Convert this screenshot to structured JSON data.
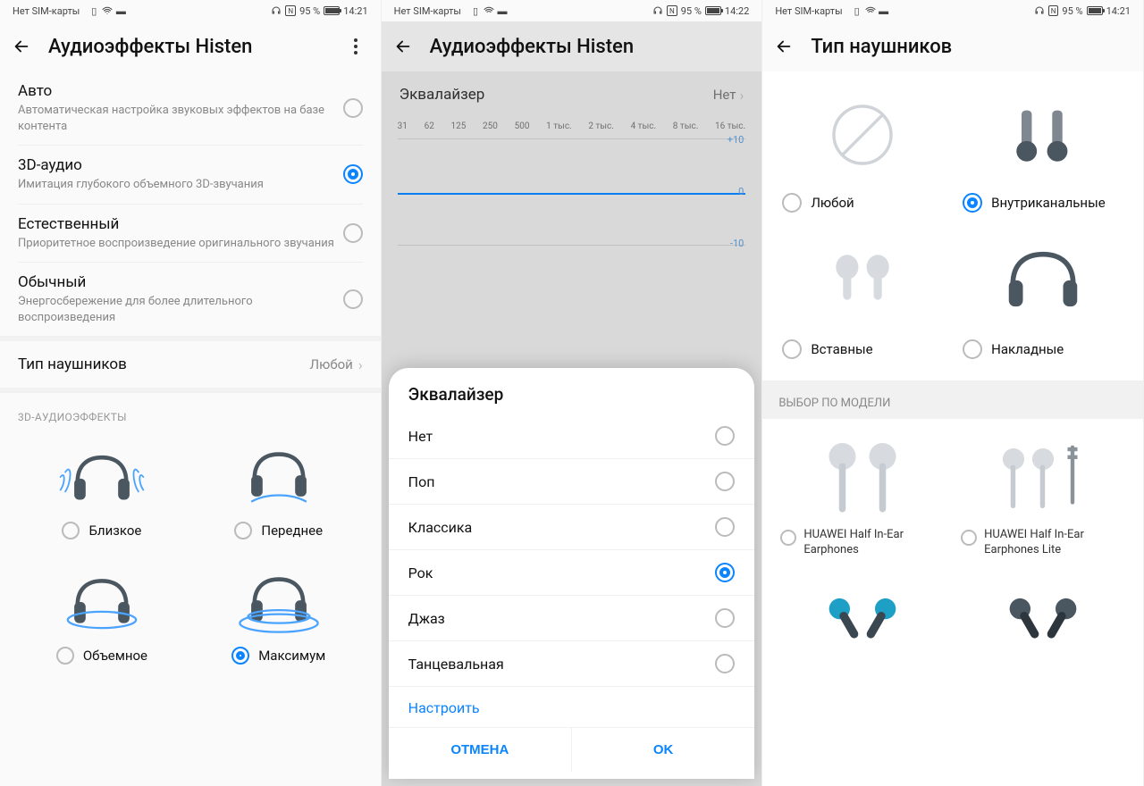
{
  "statusbar": {
    "sim": "Нет SIM-карты",
    "nfc": "N",
    "battery_pct": "95 %",
    "time1": "14:21",
    "time2": "14:22"
  },
  "screen1": {
    "title": "Аудиоэффекты Histen",
    "modes": [
      {
        "title": "Авто",
        "sub": "Автоматическая настройка звуковых эффектов на базе контента",
        "selected": false
      },
      {
        "title": "3D-аудио",
        "sub": "Имитация глубокого объемного 3D-звучания",
        "selected": true
      },
      {
        "title": "Естественный",
        "sub": "Приоритетное воспроизведение оригинального звучания",
        "selected": false
      },
      {
        "title": "Обычный",
        "sub": "Энергосбережение для более длительного воспроизведения",
        "selected": false
      }
    ],
    "navrow": {
      "title": "Тип наушников",
      "value": "Любой"
    },
    "section": "3D-АУДИОЭФФЕКТЫ",
    "effects": [
      {
        "label": "Близкое",
        "selected": false
      },
      {
        "label": "Переднее",
        "selected": false
      },
      {
        "label": "Объемное",
        "selected": false
      },
      {
        "label": "Максимум",
        "selected": true
      }
    ]
  },
  "screen2": {
    "title": "Аудиоэффекты Histen",
    "eq_row": {
      "title": "Эквалайзер",
      "value": "Нет"
    },
    "bands": [
      "31",
      "62",
      "125",
      "250",
      "500",
      "1 тыс.",
      "2 тыс.",
      "4 тыс.",
      "8 тыс.",
      "16 тыс."
    ],
    "scale": {
      "top": "+10",
      "mid": "0",
      "bot": "-10"
    },
    "dialog_title": "Эквалайзер",
    "presets": [
      {
        "label": "Нет",
        "selected": false
      },
      {
        "label": "Поп",
        "selected": false
      },
      {
        "label": "Классика",
        "selected": false
      },
      {
        "label": "Рок",
        "selected": true
      },
      {
        "label": "Джаз",
        "selected": false
      },
      {
        "label": "Танцевальная",
        "selected": false
      }
    ],
    "customize": "Настроить",
    "cancel": "ОТМЕНА",
    "ok": "OK"
  },
  "screen3": {
    "title": "Тип наушников",
    "types": [
      {
        "label": "Любой",
        "selected": false
      },
      {
        "label": "Внутриканальные",
        "selected": true
      },
      {
        "label": "Вставные",
        "selected": false
      },
      {
        "label": "Накладные",
        "selected": false
      }
    ],
    "models_header": "ВЫБОР ПО МОДЕЛИ",
    "models": [
      {
        "label": "HUAWEI Half In-Ear Earphones",
        "selected": false
      },
      {
        "label": "HUAWEI Half In-Ear Earphones Lite",
        "selected": false
      }
    ]
  }
}
